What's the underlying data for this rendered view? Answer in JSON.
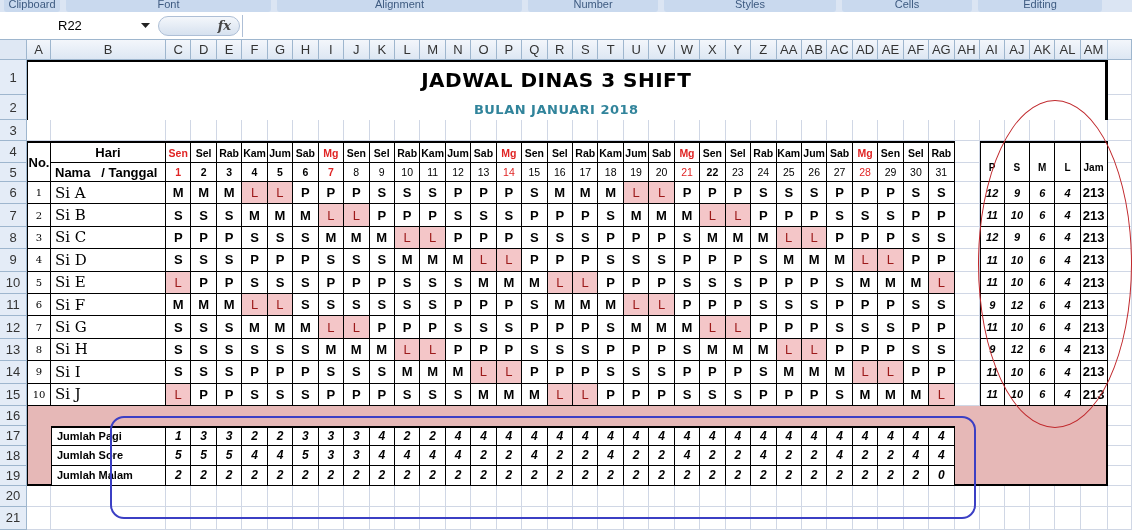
{
  "ribbon": {
    "groups": [
      "Clipboard",
      "Font",
      "Alignment",
      "Number",
      "Styles",
      "Cells",
      "Editing"
    ]
  },
  "formula_bar": {
    "name_box": "R22",
    "function_label": "fx"
  },
  "sheet": {
    "column_headers": [
      "A",
      "B",
      "C",
      "D",
      "E",
      "F",
      "G",
      "H",
      "I",
      "J",
      "K",
      "L",
      "M",
      "N",
      "O",
      "P",
      "Q",
      "R",
      "S",
      "T",
      "U",
      "V",
      "W",
      "X",
      "Y",
      "Z",
      "AA",
      "AB",
      "AC",
      "AD",
      "AE",
      "AF",
      "AG",
      "AH",
      "AI",
      "AJ",
      "AK",
      "AL",
      "AM"
    ],
    "row_headers": [
      "1",
      "2",
      "3",
      "4",
      "5",
      "6",
      "7",
      "8",
      "9",
      "10",
      "11",
      "12",
      "13",
      "14",
      "15",
      "16",
      "17",
      "18",
      "19",
      "20",
      "21"
    ],
    "title": "JADWAL DINAS 3 SHIFT",
    "subtitle": "BULAN JANUARI 2018",
    "header": {
      "no": "No.",
      "day": "Hari",
      "name_date": "Nama   / Tanggal"
    },
    "days": [
      {
        "day": "Sen",
        "date": "1",
        "holiday": true,
        "bold": true
      },
      {
        "day": "Sel",
        "date": "2",
        "holiday": false,
        "bold": true
      },
      {
        "day": "Rab",
        "date": "3",
        "holiday": false,
        "bold": true
      },
      {
        "day": "Kam",
        "date": "4",
        "holiday": false,
        "bold": true
      },
      {
        "day": "Jum",
        "date": "5",
        "holiday": false,
        "bold": true
      },
      {
        "day": "Sab",
        "date": "6",
        "holiday": false,
        "bold": true
      },
      {
        "day": "Mg",
        "date": "7",
        "holiday": true,
        "bold": true
      },
      {
        "day": "Sen",
        "date": "8",
        "holiday": false,
        "bold": false
      },
      {
        "day": "Sel",
        "date": "9",
        "holiday": false,
        "bold": false
      },
      {
        "day": "Rab",
        "date": "10",
        "holiday": false,
        "bold": false
      },
      {
        "day": "Kam",
        "date": "11",
        "holiday": false,
        "bold": false
      },
      {
        "day": "Jum",
        "date": "12",
        "holiday": false,
        "bold": false
      },
      {
        "day": "Sab",
        "date": "13",
        "holiday": false,
        "bold": false
      },
      {
        "day": "Mg",
        "date": "14",
        "holiday": true,
        "bold": false
      },
      {
        "day": "Sen",
        "date": "15",
        "holiday": false,
        "bold": false
      },
      {
        "day": "Sel",
        "date": "16",
        "holiday": false,
        "bold": false
      },
      {
        "day": "Rab",
        "date": "17",
        "holiday": false,
        "bold": false
      },
      {
        "day": "Kam",
        "date": "18",
        "holiday": false,
        "bold": false
      },
      {
        "day": "Jum",
        "date": "19",
        "holiday": false,
        "bold": false
      },
      {
        "day": "Sab",
        "date": "20",
        "holiday": false,
        "bold": false
      },
      {
        "day": "Mg",
        "date": "21",
        "holiday": true,
        "bold": false
      },
      {
        "day": "Sen",
        "date": "22",
        "holiday": false,
        "bold": true
      },
      {
        "day": "Sel",
        "date": "23",
        "holiday": false,
        "bold": false
      },
      {
        "day": "Rab",
        "date": "24",
        "holiday": false,
        "bold": false
      },
      {
        "day": "Kam",
        "date": "25",
        "holiday": false,
        "bold": false
      },
      {
        "day": "Jum",
        "date": "26",
        "holiday": false,
        "bold": false
      },
      {
        "day": "Sab",
        "date": "27",
        "holiday": false,
        "bold": false
      },
      {
        "day": "Mg",
        "date": "28",
        "holiday": true,
        "bold": false
      },
      {
        "day": "Sen",
        "date": "29",
        "holiday": false,
        "bold": false
      },
      {
        "day": "Sel",
        "date": "30",
        "holiday": false,
        "bold": false
      },
      {
        "day": "Rab",
        "date": "31",
        "holiday": false,
        "bold": false
      }
    ],
    "total_columns": [
      "P",
      "S",
      "M",
      "L",
      "Jam"
    ],
    "staff": [
      {
        "no": "1",
        "name": "Si A",
        "shifts": [
          "M",
          "M",
          "M",
          "L",
          "L",
          "P",
          "P",
          "P",
          "S",
          "S",
          "S",
          "P",
          "P",
          "P",
          "S",
          "M",
          "M",
          "M",
          "L",
          "L",
          "P",
          "P",
          "P",
          "S",
          "S",
          "S",
          "P",
          "P",
          "P",
          "S",
          "S"
        ],
        "off": [
          false,
          false,
          false,
          true,
          true,
          false,
          false,
          false,
          false,
          false,
          false,
          false,
          false,
          false,
          false,
          false,
          false,
          false,
          true,
          true,
          false,
          false,
          false,
          false,
          false,
          false,
          false,
          false,
          false,
          false,
          false
        ],
        "totals": [
          "12",
          "9",
          "6",
          "4",
          "213"
        ]
      },
      {
        "no": "2",
        "name": "Si B",
        "shifts": [
          "S",
          "S",
          "S",
          "M",
          "M",
          "M",
          "L",
          "L",
          "P",
          "P",
          "P",
          "S",
          "S",
          "S",
          "P",
          "P",
          "P",
          "S",
          "M",
          "M",
          "M",
          "L",
          "L",
          "P",
          "P",
          "P",
          "S",
          "S",
          "S",
          "P",
          "P"
        ],
        "off": [
          false,
          false,
          false,
          false,
          false,
          false,
          true,
          true,
          false,
          false,
          false,
          false,
          false,
          false,
          false,
          false,
          false,
          false,
          false,
          false,
          false,
          true,
          true,
          false,
          false,
          false,
          false,
          false,
          false,
          false,
          false
        ],
        "totals": [
          "11",
          "10",
          "6",
          "4",
          "213"
        ]
      },
      {
        "no": "3",
        "name": "Si C",
        "shifts": [
          "P",
          "P",
          "P",
          "S",
          "S",
          "S",
          "M",
          "M",
          "M",
          "L",
          "L",
          "P",
          "P",
          "P",
          "S",
          "S",
          "S",
          "P",
          "P",
          "P",
          "S",
          "M",
          "M",
          "M",
          "L",
          "L",
          "P",
          "P",
          "P",
          "S",
          "S"
        ],
        "off": [
          false,
          false,
          false,
          false,
          false,
          false,
          false,
          false,
          false,
          true,
          true,
          false,
          false,
          false,
          false,
          false,
          false,
          false,
          false,
          false,
          false,
          false,
          false,
          false,
          true,
          true,
          false,
          false,
          false,
          false,
          false
        ],
        "totals": [
          "12",
          "9",
          "6",
          "4",
          "213"
        ]
      },
      {
        "no": "4",
        "name": "Si D",
        "shifts": [
          "S",
          "S",
          "S",
          "P",
          "P",
          "P",
          "S",
          "S",
          "S",
          "M",
          "M",
          "M",
          "L",
          "L",
          "P",
          "P",
          "P",
          "S",
          "S",
          "S",
          "P",
          "P",
          "P",
          "S",
          "M",
          "M",
          "M",
          "L",
          "L",
          "P",
          "P"
        ],
        "off": [
          false,
          false,
          false,
          false,
          false,
          false,
          false,
          false,
          false,
          false,
          false,
          false,
          true,
          true,
          false,
          false,
          false,
          false,
          false,
          false,
          false,
          false,
          false,
          false,
          false,
          false,
          false,
          true,
          true,
          false,
          false
        ],
        "totals": [
          "11",
          "10",
          "6",
          "4",
          "213"
        ]
      },
      {
        "no": "5",
        "name": "Si E",
        "shifts": [
          "L",
          "P",
          "P",
          "S",
          "S",
          "S",
          "P",
          "P",
          "P",
          "S",
          "S",
          "S",
          "M",
          "M",
          "M",
          "L",
          "L",
          "P",
          "P",
          "P",
          "S",
          "S",
          "S",
          "P",
          "P",
          "P",
          "S",
          "M",
          "M",
          "M",
          "L"
        ],
        "off": [
          true,
          false,
          false,
          false,
          false,
          false,
          false,
          false,
          false,
          false,
          false,
          false,
          false,
          false,
          false,
          true,
          true,
          false,
          false,
          false,
          false,
          false,
          false,
          false,
          false,
          false,
          false,
          false,
          false,
          false,
          true
        ],
        "totals": [
          "11",
          "10",
          "6",
          "4",
          "213"
        ]
      },
      {
        "no": "6",
        "name": "Si F",
        "shifts": [
          "M",
          "M",
          "M",
          "L",
          "L",
          "S",
          "S",
          "S",
          "S",
          "S",
          "S",
          "P",
          "P",
          "P",
          "S",
          "M",
          "M",
          "M",
          "L",
          "L",
          "P",
          "P",
          "P",
          "S",
          "S",
          "S",
          "P",
          "P",
          "P",
          "S",
          "S"
        ],
        "off": [
          false,
          false,
          false,
          true,
          true,
          false,
          false,
          false,
          false,
          false,
          false,
          false,
          false,
          false,
          false,
          false,
          false,
          false,
          true,
          true,
          false,
          false,
          false,
          false,
          false,
          false,
          false,
          false,
          false,
          false,
          false
        ],
        "totals": [
          "9",
          "12",
          "6",
          "4",
          "213"
        ]
      },
      {
        "no": "7",
        "name": "Si G",
        "shifts": [
          "S",
          "S",
          "S",
          "M",
          "M",
          "M",
          "L",
          "L",
          "P",
          "P",
          "P",
          "S",
          "S",
          "S",
          "P",
          "P",
          "P",
          "S",
          "M",
          "M",
          "M",
          "L",
          "L",
          "P",
          "P",
          "P",
          "S",
          "S",
          "S",
          "P",
          "P"
        ],
        "off": [
          false,
          false,
          false,
          false,
          false,
          false,
          true,
          true,
          false,
          false,
          false,
          false,
          false,
          false,
          false,
          false,
          false,
          false,
          false,
          false,
          false,
          true,
          true,
          false,
          false,
          false,
          false,
          false,
          false,
          false,
          false
        ],
        "totals": [
          "11",
          "10",
          "6",
          "4",
          "213"
        ]
      },
      {
        "no": "8",
        "name": "Si H",
        "shifts": [
          "S",
          "S",
          "S",
          "S",
          "S",
          "S",
          "M",
          "M",
          "M",
          "L",
          "L",
          "P",
          "P",
          "P",
          "S",
          "S",
          "S",
          "P",
          "P",
          "P",
          "S",
          "M",
          "M",
          "M",
          "L",
          "L",
          "P",
          "P",
          "P",
          "S",
          "S"
        ],
        "off": [
          false,
          false,
          false,
          false,
          false,
          false,
          false,
          false,
          false,
          true,
          true,
          false,
          false,
          false,
          false,
          false,
          false,
          false,
          false,
          false,
          false,
          false,
          false,
          false,
          true,
          true,
          false,
          false,
          false,
          false,
          false
        ],
        "totals": [
          "9",
          "12",
          "6",
          "4",
          "213"
        ]
      },
      {
        "no": "9",
        "name": "Si I",
        "shifts": [
          "S",
          "S",
          "S",
          "P",
          "P",
          "P",
          "S",
          "S",
          "S",
          "M",
          "M",
          "M",
          "L",
          "L",
          "P",
          "P",
          "P",
          "S",
          "S",
          "S",
          "P",
          "P",
          "P",
          "S",
          "M",
          "M",
          "M",
          "L",
          "L",
          "P",
          "P"
        ],
        "off": [
          false,
          false,
          false,
          false,
          false,
          false,
          false,
          false,
          false,
          false,
          false,
          false,
          true,
          true,
          false,
          false,
          false,
          false,
          false,
          false,
          false,
          false,
          false,
          false,
          false,
          false,
          false,
          true,
          true,
          false,
          false
        ],
        "totals": [
          "11",
          "10",
          "6",
          "4",
          "213"
        ]
      },
      {
        "no": "10",
        "name": "Si J",
        "shifts": [
          "L",
          "P",
          "P",
          "S",
          "S",
          "S",
          "P",
          "P",
          "P",
          "S",
          "S",
          "S",
          "M",
          "M",
          "M",
          "L",
          "L",
          "P",
          "P",
          "P",
          "S",
          "S",
          "S",
          "P",
          "P",
          "P",
          "S",
          "M",
          "M",
          "M",
          "L"
        ],
        "off": [
          true,
          false,
          false,
          false,
          false,
          false,
          false,
          false,
          false,
          false,
          false,
          false,
          false,
          false,
          false,
          true,
          true,
          false,
          false,
          false,
          false,
          false,
          false,
          false,
          false,
          false,
          false,
          false,
          false,
          false,
          true
        ],
        "totals": [
          "11",
          "10",
          "6",
          "4",
          "213"
        ]
      }
    ],
    "summary": [
      {
        "label": "Jumlah Pagi",
        "values": [
          "1",
          "3",
          "3",
          "2",
          "2",
          "3",
          "3",
          "3",
          "4",
          "2",
          "2",
          "4",
          "4",
          "4",
          "4",
          "4",
          "4",
          "4",
          "4",
          "4",
          "4",
          "4",
          "4",
          "4",
          "4",
          "4",
          "4",
          "4",
          "4",
          "4",
          "4"
        ]
      },
      {
        "label": "Jumlah Sore",
        "values": [
          "5",
          "5",
          "5",
          "4",
          "4",
          "5",
          "3",
          "3",
          "4",
          "4",
          "4",
          "4",
          "2",
          "2",
          "4",
          "2",
          "2",
          "4",
          "2",
          "2",
          "4",
          "2",
          "2",
          "4",
          "2",
          "2",
          "4",
          "2",
          "2",
          "4",
          "4"
        ]
      },
      {
        "label": "Jumlah Malam",
        "values": [
          "2",
          "2",
          "2",
          "2",
          "2",
          "2",
          "2",
          "2",
          "2",
          "2",
          "2",
          "2",
          "2",
          "2",
          "2",
          "2",
          "2",
          "2",
          "2",
          "2",
          "2",
          "2",
          "2",
          "2",
          "2",
          "2",
          "2",
          "2",
          "2",
          "2",
          "0"
        ]
      }
    ]
  }
}
